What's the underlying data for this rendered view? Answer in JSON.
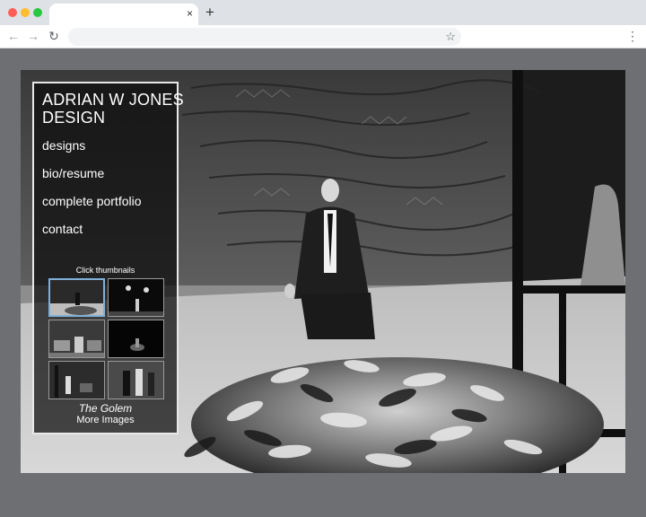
{
  "browser": {
    "tab_title": "",
    "close_glyph": "×",
    "new_tab_glyph": "+",
    "back_glyph": "←",
    "forward_glyph": "→",
    "reload_glyph": "↻",
    "url": "",
    "star_glyph": "☆",
    "menu_glyph": "⋮"
  },
  "site": {
    "brand_line1": "ADRIAN W JONES",
    "brand_line2": "DESIGN",
    "nav": [
      {
        "label": "designs"
      },
      {
        "label": "bio/resume"
      },
      {
        "label": "complete portfolio"
      },
      {
        "label": "contact"
      }
    ],
    "thumbnails_hint": "Click thumbnails",
    "thumbnails": [
      {
        "icon": "stage-photo-thumbnail",
        "active": true
      },
      {
        "icon": "stage-photo-thumbnail",
        "active": false
      },
      {
        "icon": "stage-photo-thumbnail",
        "active": false
      },
      {
        "icon": "stage-photo-thumbnail",
        "active": false
      },
      {
        "icon": "stage-photo-thumbnail",
        "active": false
      },
      {
        "icon": "stage-photo-thumbnail",
        "active": false
      }
    ],
    "production_title": "The Golem",
    "more_images_label": "More Images"
  },
  "colors": {
    "page_background": "#6e6f73",
    "sidebar_border": "#e8e8e8",
    "active_thumb_border": "#7fb0d8"
  }
}
